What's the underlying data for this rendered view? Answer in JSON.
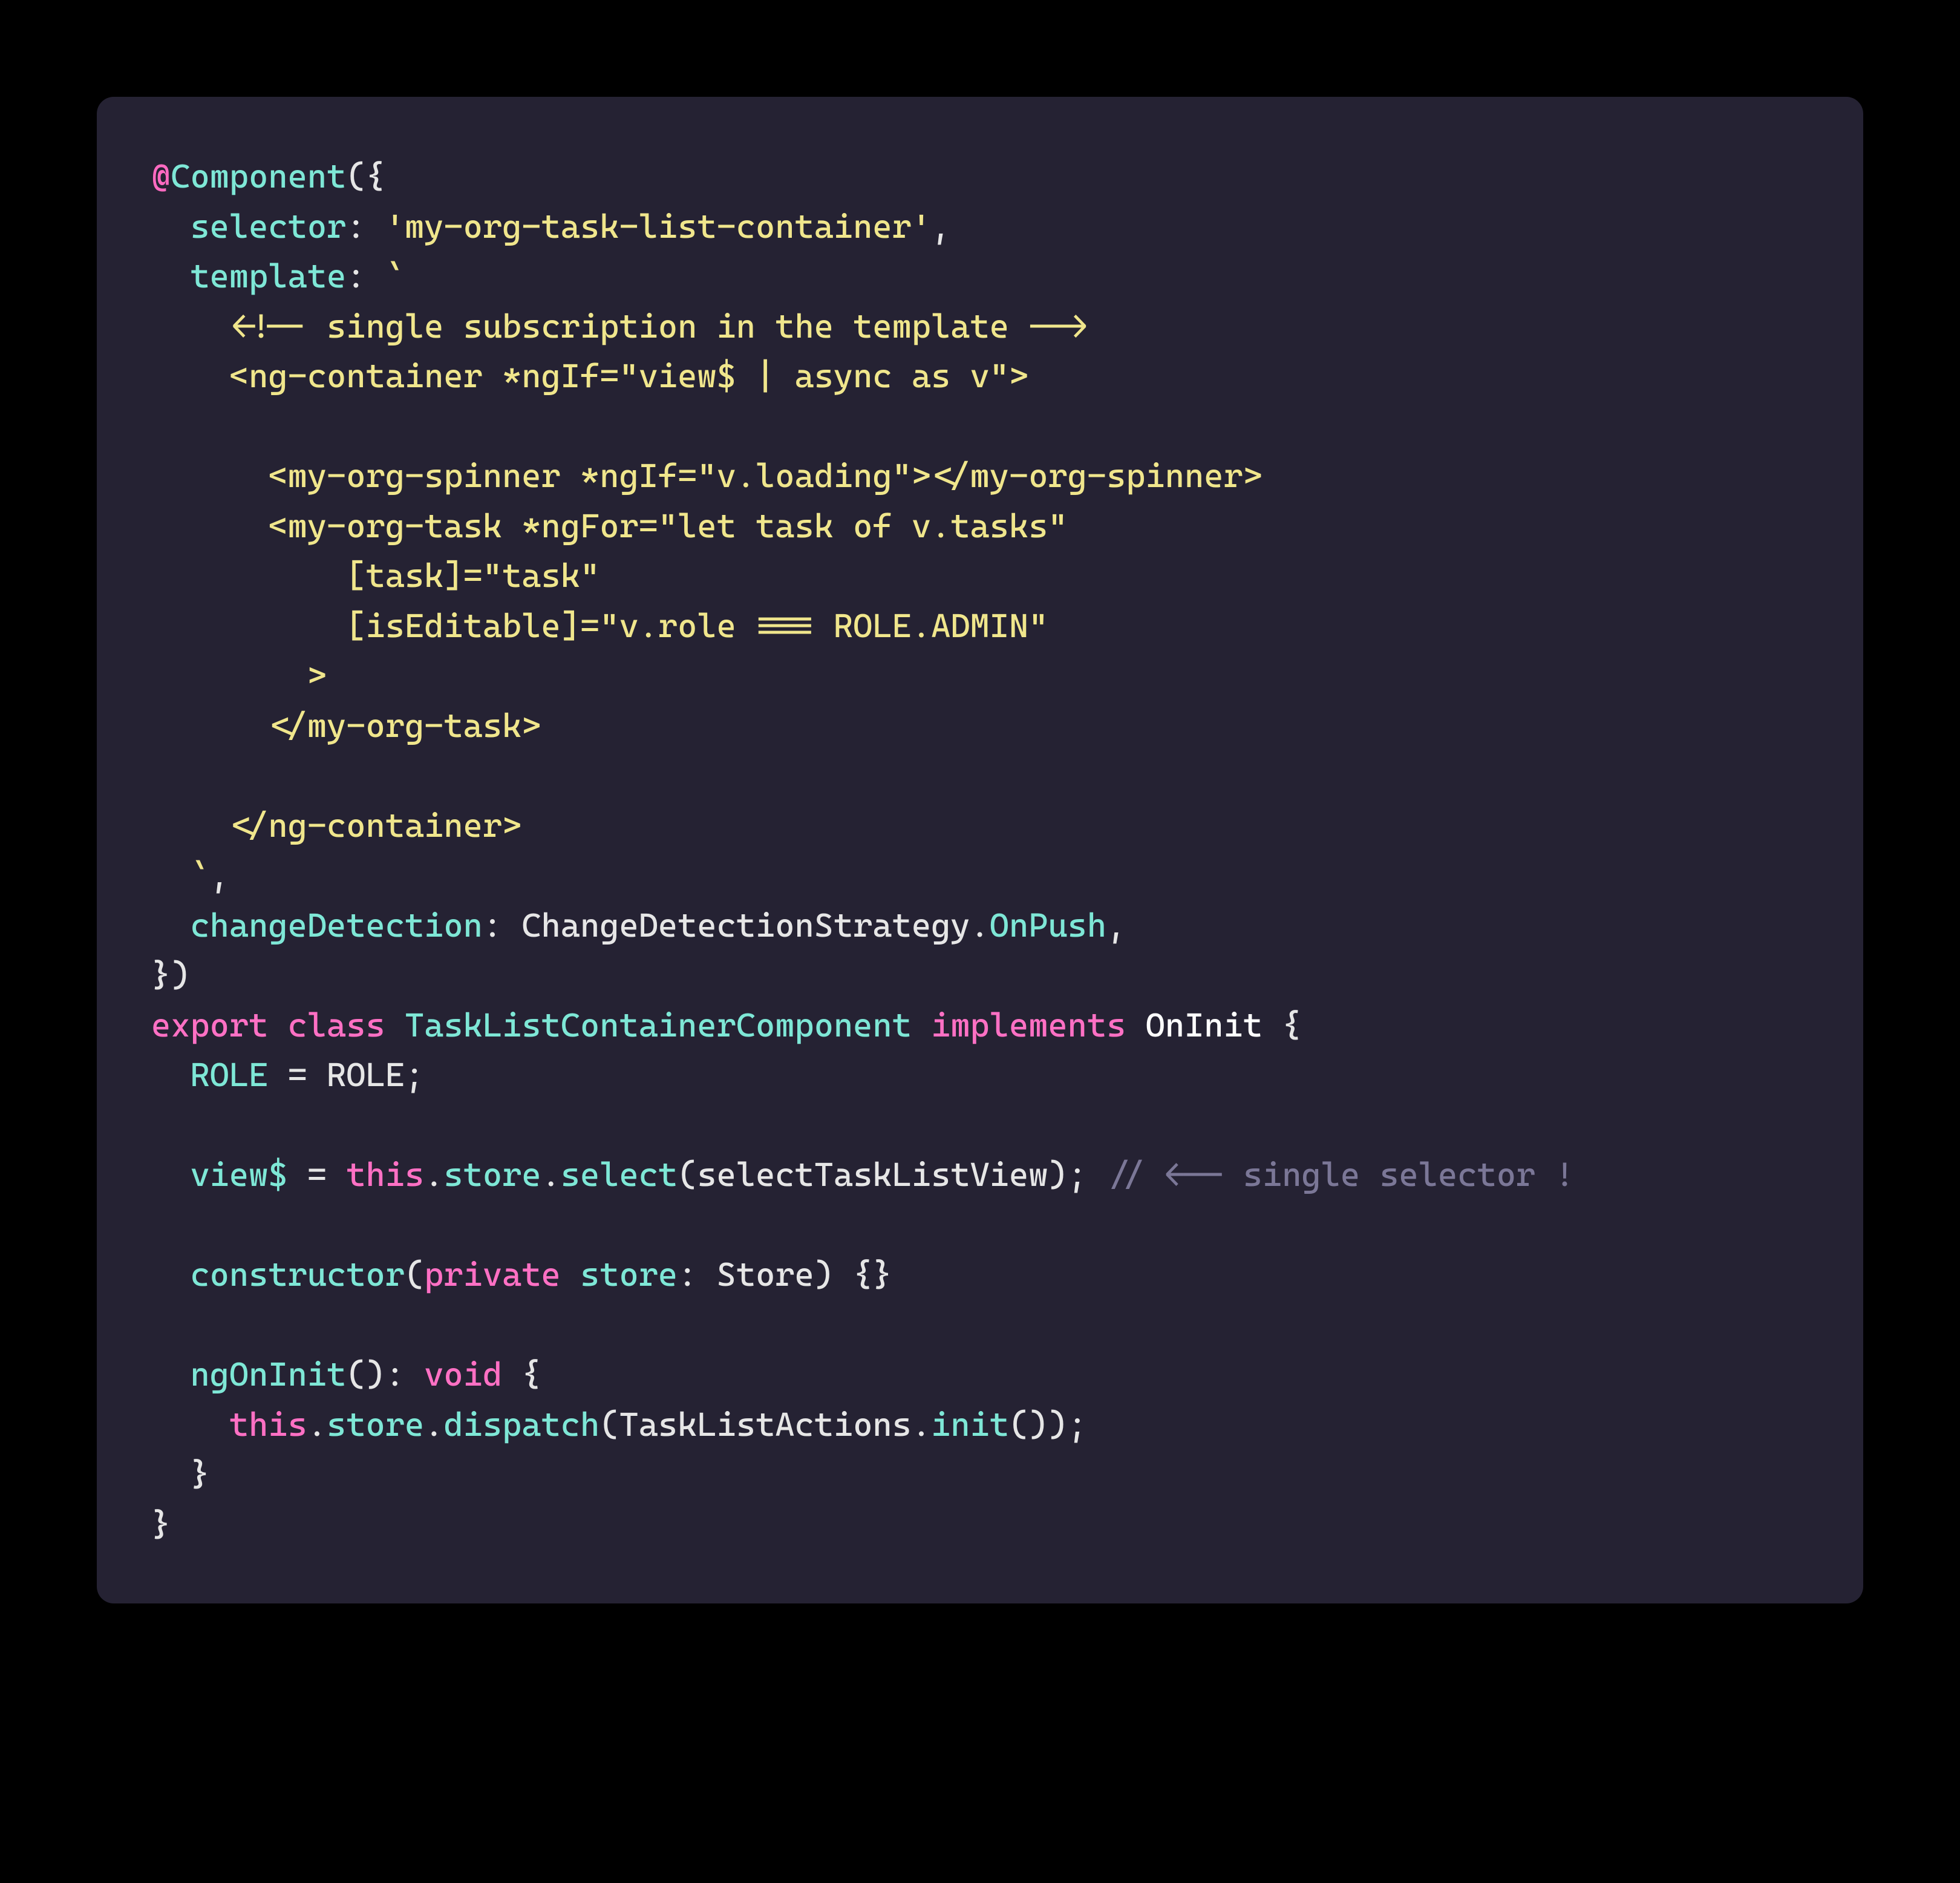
{
  "code": {
    "l01": {
      "a": "@",
      "b": "Component",
      "c": "({"
    },
    "l02": {
      "indent": "  ",
      "key": "selector",
      "colon": ": ",
      "val": "'my-org-task-list-container'",
      "comma": ","
    },
    "l03": {
      "indent": "  ",
      "key": "template",
      "colon": ": ",
      "tick": "`"
    },
    "l04": "    <!-- single subscription in the template -->",
    "l05": "    <ng-container *ngIf=\"view$ | async as v\">",
    "l06": "",
    "l07": "      <my-org-spinner *ngIf=\"v.loading\"></my-org-spinner>",
    "l08": "      <my-org-task *ngFor=\"let task of v.tasks\"",
    "l09": "          [task]=\"task\"",
    "l10": "          [isEditable]=\"v.role === ROLE.ADMIN\"",
    "l11": "        >",
    "l12": "      </my-org-task>",
    "l13": "",
    "l14": "    </ng-container>",
    "l15": {
      "indent": "  ",
      "tick": "`",
      "comma": ","
    },
    "l16": {
      "indent": "  ",
      "key": "changeDetection",
      "colon": ": ",
      "a": "ChangeDetectionStrategy",
      "dot": ".",
      "b": "OnPush",
      "comma": ","
    },
    "l17": "})",
    "l18": {
      "a": "export",
      "b": " ",
      "c": "class",
      "d": " ",
      "e": "TaskListContainerComponent",
      "f": " ",
      "g": "implements",
      "h": " ",
      "i": "OnInit",
      "j": " {"
    },
    "l19": {
      "indent": "  ",
      "a": "ROLE",
      "b": " = ",
      "c": "ROLE",
      "d": ";"
    },
    "l20": "",
    "l21": {
      "indent": "  ",
      "a": "view$",
      "b": " = ",
      "c": "this",
      "d": ".",
      "e": "store",
      "f": ".",
      "g": "select",
      "h": "(",
      "i": "selectTaskListView",
      "j": "); ",
      "k": "// <-- single selector !"
    },
    "l22": "",
    "l23": {
      "indent": "  ",
      "a": "constructor",
      "b": "(",
      "c": "private",
      "d": " ",
      "e": "store",
      "f": ": ",
      "g": "Store",
      "h": ") {}"
    },
    "l24": "",
    "l25": {
      "indent": "  ",
      "a": "ngOnInit",
      "b": "(): ",
      "c": "void",
      "d": " {"
    },
    "l26": {
      "indent": "    ",
      "a": "this",
      "b": ".",
      "c": "store",
      "d": ".",
      "e": "dispatch",
      "f": "(",
      "g": "TaskListActions",
      "h": ".",
      "i": "init",
      "j": "());"
    },
    "l27": "  }",
    "l28": "}"
  }
}
